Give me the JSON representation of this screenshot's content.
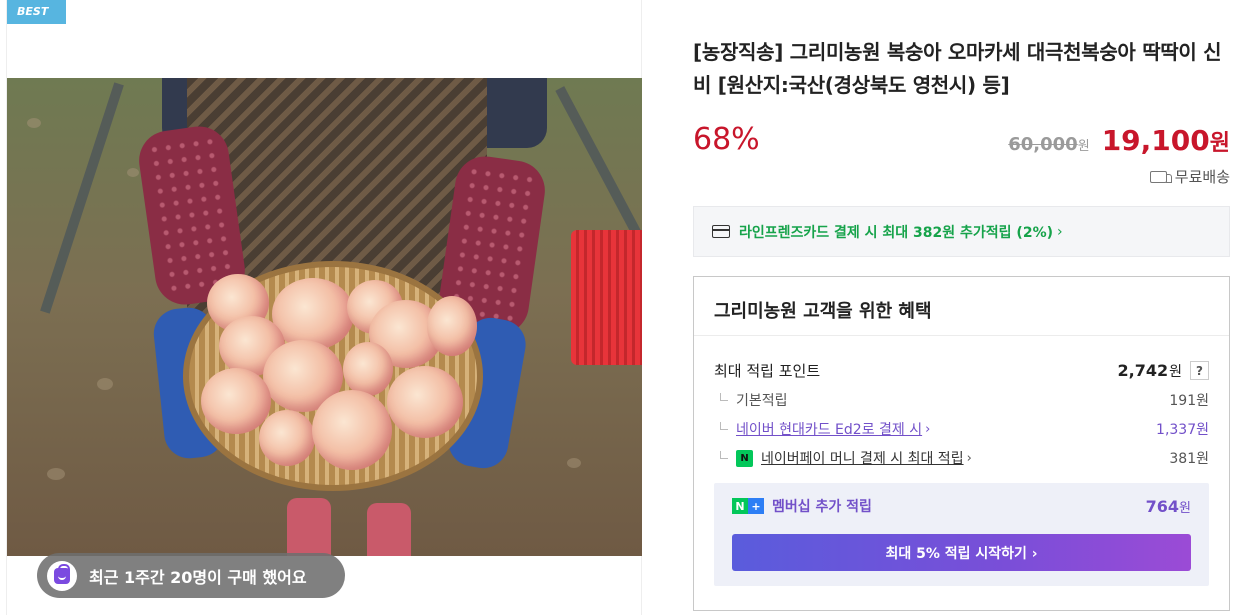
{
  "left": {
    "badge": "BEST",
    "purchase_notice": "최근 1주간 20명이 구매 했어요"
  },
  "product": {
    "title": "[농장직송] 그리미농원 복숭아 오마카세 대극천복숭아 딱딱이 신비 [원산지:국산(경상북도 영천시) 등]",
    "discount": "68%",
    "original_price": "60,000",
    "original_unit": "원",
    "sale_price": "19,100",
    "sale_unit": "원",
    "shipping": "무료배송"
  },
  "card_promo": {
    "text": "라인프렌즈카드 결제 시 최대 382원 추가적립 (2%)",
    "chevron": "›"
  },
  "benefits": {
    "title": "그리미농원 고객을 위한 혜택",
    "max_points_label": "최대 적립 포인트",
    "max_points_value": "2,742",
    "max_points_unit": "원",
    "help": "?",
    "rows": [
      {
        "label": "기본적립",
        "value": "191원"
      },
      {
        "label": "네이버 현대카드 Ed2로 결제 시",
        "value": "1,337원"
      },
      {
        "label": "네이버페이 머니 결제 시 최대 적립",
        "value": "381원"
      }
    ],
    "npay_icon_text": "N",
    "membership": {
      "label": "멤버십 추가 적립",
      "value": "764",
      "unit": "원",
      "badge_n": "N",
      "badge_plus": "+",
      "button": "최대 5% 적립 시작하기 ›"
    }
  },
  "icons": {
    "bag": "shopping-bag-icon",
    "truck": "truck-icon",
    "card": "credit-card-icon"
  },
  "colors": {
    "accent_red": "#c8162b",
    "promo_green": "#16a34a",
    "purple": "#7250c9",
    "badge_blue": "#57b5e0"
  }
}
